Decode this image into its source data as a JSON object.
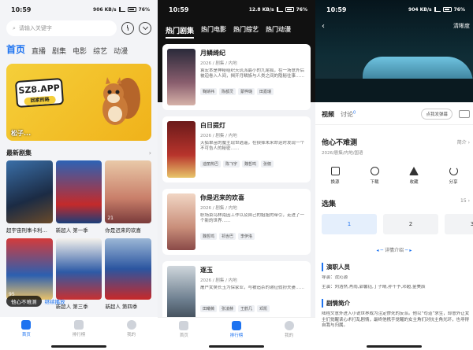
{
  "colors": {
    "accent": "#1e73f0",
    "banner": "#f5cf3a",
    "dark_header": "#111111"
  },
  "status": {
    "time": "10:59",
    "battery": "76%",
    "net1": "906 KB/s",
    "net2": "12.8 KB/s",
    "net3": "904 KB/s"
  },
  "home": {
    "search_placeholder": "请输入关键字",
    "tabs": [
      "首页",
      "直播",
      "剧集",
      "电影",
      "综艺",
      "动漫"
    ],
    "banner": {
      "logo": "SZ8.APP",
      "badge": "回家的路",
      "caption": "松子..."
    },
    "section_title": "最新剧集",
    "row1": [
      {
        "title": "超宇宙刑事卡利…",
        "ep": ""
      },
      {
        "title": "新超人 第一季",
        "ep": ""
      },
      {
        "title": "你是迟来的欢喜",
        "ep": "21"
      }
    ],
    "row2": [
      {
        "title": "",
        "ep": "95"
      },
      {
        "title": "新超人 第三季",
        "ep": ""
      },
      {
        "title": "新超人 第四季",
        "ep": ""
      }
    ],
    "toast": {
      "text": "他心不难测",
      "action": "继续播放"
    },
    "bottom_tabs": [
      "首页",
      "排行榜",
      "我的"
    ]
  },
  "rank": {
    "tabs": [
      "热门剧集",
      "热门电影",
      "热门综艺",
      "热门动漫"
    ],
    "items": [
      {
        "name": "月鳞绮纪",
        "meta": "2026 / 剧集 / 内地",
        "desc": "袁宏本是神秘组织天玑派最小的九尾狐，在一场意外后被迫卷入人间，揭开月鳞族与人类之间的隐秘往事……",
        "chips": [
          "鞠婧祎",
          "陈都灵",
          "蒙桦璐",
          "田嘉瑞"
        ]
      },
      {
        "name": "白日提灯",
        "meta": "2026 / 剧集 / 内地",
        "desc": "天狐单苗的魔主现世逍遥，在抉择未来命运时发现一个不可告人的秘密……",
        "chips": [
          "迪丽热巴",
          "陈飞宇",
          "魏哲鸣",
          "张俪"
        ]
      },
      {
        "name": "你是迟来的欢喜",
        "meta": "2026 / 剧集 / 内地",
        "desc": "职场菜鸟林南因工作以及自己的姐姐的牵引，走进了一个新的世界……",
        "chips": [
          "魏哲鸣",
          "祁含巴",
          "李伊洛"
        ]
      },
      {
        "name": "逐玉",
        "meta": "2026 / 剧集 / 内地",
        "desc": "屠户女樊长玉为保家业，与被追杀的谢征假扮夫妻……",
        "chips": [
          "田曦薇",
          "张凌赫",
          "王鹤几",
          "邓凯"
        ]
      }
    ],
    "bottom_tabs": [
      "首页",
      "排行榜",
      "我的"
    ]
  },
  "detail": {
    "quality": "清晰度",
    "tabs": {
      "video": "视频",
      "comment": "讨论",
      "comment_badge": "0"
    },
    "danmu": "点我发弹幕",
    "title": "他心不难测",
    "intro": "简介 ›",
    "meta": "2026/剧集/内地/国语",
    "actions": [
      "换源",
      "下载",
      "收藏",
      "分享"
    ],
    "episodes_label": "选集",
    "episodes_count": "15 ›",
    "episodes": [
      "1",
      "2",
      "3"
    ],
    "collapse": "详情介绍",
    "cast_head": "演职人员",
    "director": "导演：沈沁源",
    "cast": "主演：刘浩然,肖雨,郭馨钰,丁子晴,孙千予,邓超,金美辰",
    "plot_head": "剧情简介",
    "plot": "陆程文意外进入小说世界成为注定惨死的反派。他以“苟道”求生，却意外让女主们觉醒读心术打乱剧情，最终他携手觉醒的女主角们对抗主角光环，也寻得自我与归属。"
  }
}
